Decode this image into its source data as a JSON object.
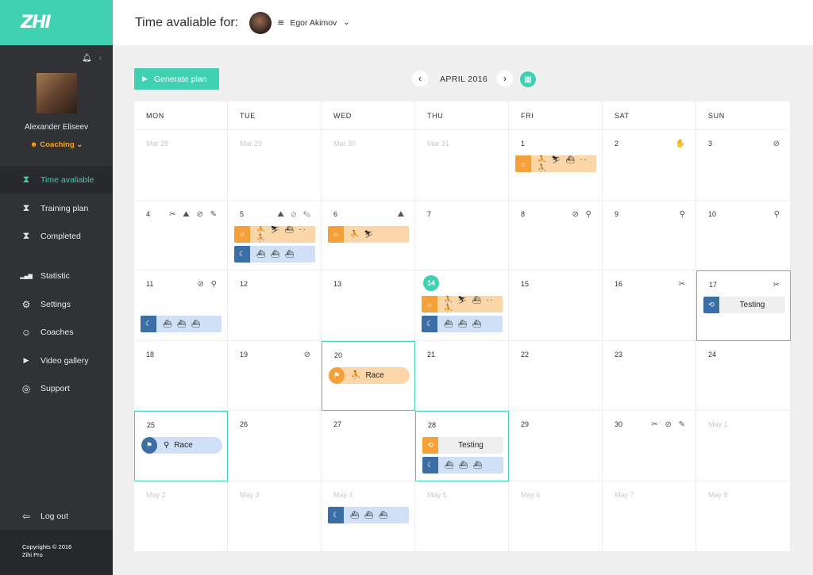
{
  "sidebar": {
    "logo": "ZHI",
    "user_name": "Alexander Eliseev",
    "role": "Coaching",
    "nav": [
      {
        "label": "Time avaliable",
        "icon": "hourglass-icon",
        "glyph": "⧗"
      },
      {
        "label": "Training plan",
        "icon": "hourglass-icon",
        "glyph": "⧗"
      },
      {
        "label": "Completed",
        "icon": "hourglass-icon",
        "glyph": "⧗"
      },
      {
        "label": "Statistic",
        "icon": "bar-chart-icon",
        "glyph": "▂▄▆"
      },
      {
        "label": "Settings",
        "icon": "gear-icon",
        "glyph": "⚙"
      },
      {
        "label": "Coaches",
        "icon": "coach-icon",
        "glyph": "☺"
      },
      {
        "label": "Video gallery",
        "icon": "video-icon",
        "glyph": "▶"
      },
      {
        "label": "Support",
        "icon": "lifebuoy-icon",
        "glyph": "◎"
      }
    ],
    "logout": "Log out",
    "copyright_line1": "Copyrights © 2016",
    "copyright_line2": "Zihi Pro"
  },
  "header": {
    "title": "Time avaliable for:",
    "athlete": "Egor Akimov"
  },
  "toolbar": {
    "generate": "Generate plan",
    "month": "APRIL 2016"
  },
  "colors": {
    "accent": "#3fd1b1",
    "sidebar": "#303236",
    "morning": "#f4a13a",
    "evening": "#3a6ea5"
  },
  "weekdays": [
    "MON",
    "TUE",
    "WED",
    "THU",
    "FRI",
    "SAT",
    "SUN"
  ],
  "weeks": [
    [
      {
        "d": "Mar 28",
        "other": true
      },
      {
        "d": "Mar 29",
        "other": true
      },
      {
        "d": "Mar 30",
        "other": true
      },
      {
        "d": "Mar 31",
        "other": true
      },
      {
        "d": "1",
        "events": [
          {
            "kind": "morning",
            "text": "⛹ ⛷ ⛴ ·· ⛹"
          }
        ]
      },
      {
        "d": "2",
        "icons": "✋"
      },
      {
        "d": "3",
        "icons": "⊘"
      }
    ],
    [
      {
        "d": "4",
        "icons": "✂ ⛰ ⊘ ✎"
      },
      {
        "d": "5",
        "icons": "⛰ ⊘ ✎",
        "events": [
          {
            "kind": "morning",
            "text": "⛹ ⛷ ⛴ ·· ⛹"
          },
          {
            "kind": "evening",
            "text": "⛴ ⛴ ⛴"
          }
        ]
      },
      {
        "d": "6",
        "icons": "⛰",
        "events": [
          {
            "kind": "morning",
            "text": "⛹ ⛷"
          }
        ]
      },
      {
        "d": "7"
      },
      {
        "d": "8",
        "icons": "⊘ ⚲"
      },
      {
        "d": "9",
        "icons": "⚲"
      },
      {
        "d": "10",
        "icons": "⚲"
      }
    ],
    [
      {
        "d": "11",
        "icons": "⊘ ⚲",
        "events": [
          {
            "kind": "evening",
            "text": "⛴ ⛴ ⛴"
          }
        ]
      },
      {
        "d": "12"
      },
      {
        "d": "13"
      },
      {
        "d": "14",
        "today": true,
        "events": [
          {
            "kind": "morning",
            "text": "⛹ ⛷ ⛴ ·· ⛹"
          },
          {
            "kind": "evening",
            "text": "⛴ ⛴ ⛴"
          }
        ]
      },
      {
        "d": "15"
      },
      {
        "d": "16",
        "icons": "✂"
      },
      {
        "d": "17",
        "icons": "✂",
        "selected": true,
        "events": [
          {
            "kind": "test",
            "text": "Testing"
          }
        ]
      }
    ],
    [
      {
        "d": "18"
      },
      {
        "d": "19",
        "icons": "⊘"
      },
      {
        "d": "20",
        "selected": true,
        "events": [
          {
            "kind": "race-or",
            "text": "Race",
            "sport": "⛹"
          }
        ]
      },
      {
        "d": "21"
      },
      {
        "d": "22"
      },
      {
        "d": "23"
      },
      {
        "d": "24"
      }
    ],
    [
      {
        "d": "25",
        "selected": true,
        "events": [
          {
            "kind": "race-bl",
            "text": "Race",
            "sport": "⚲"
          }
        ]
      },
      {
        "d": "26"
      },
      {
        "d": "27"
      },
      {
        "d": "28",
        "selected": true,
        "events": [
          {
            "kind": "test-or",
            "text": "Testing"
          },
          {
            "kind": "evening",
            "text": "⛴ ⛴ ⛴"
          }
        ]
      },
      {
        "d": "29"
      },
      {
        "d": "30",
        "icons": "✂ ⊘ ✎"
      },
      {
        "d": "May 1",
        "other": true
      }
    ],
    [
      {
        "d": "May 2",
        "other": true
      },
      {
        "d": "May 3",
        "other": true
      },
      {
        "d": "May 4",
        "other": true,
        "events": [
          {
            "kind": "evening",
            "text": "⛴ ⛴ ⛴"
          }
        ]
      },
      {
        "d": "May 5",
        "other": true
      },
      {
        "d": "May 6",
        "other": true
      },
      {
        "d": "May 7",
        "other": true
      },
      {
        "d": "May 8",
        "other": true
      }
    ]
  ]
}
